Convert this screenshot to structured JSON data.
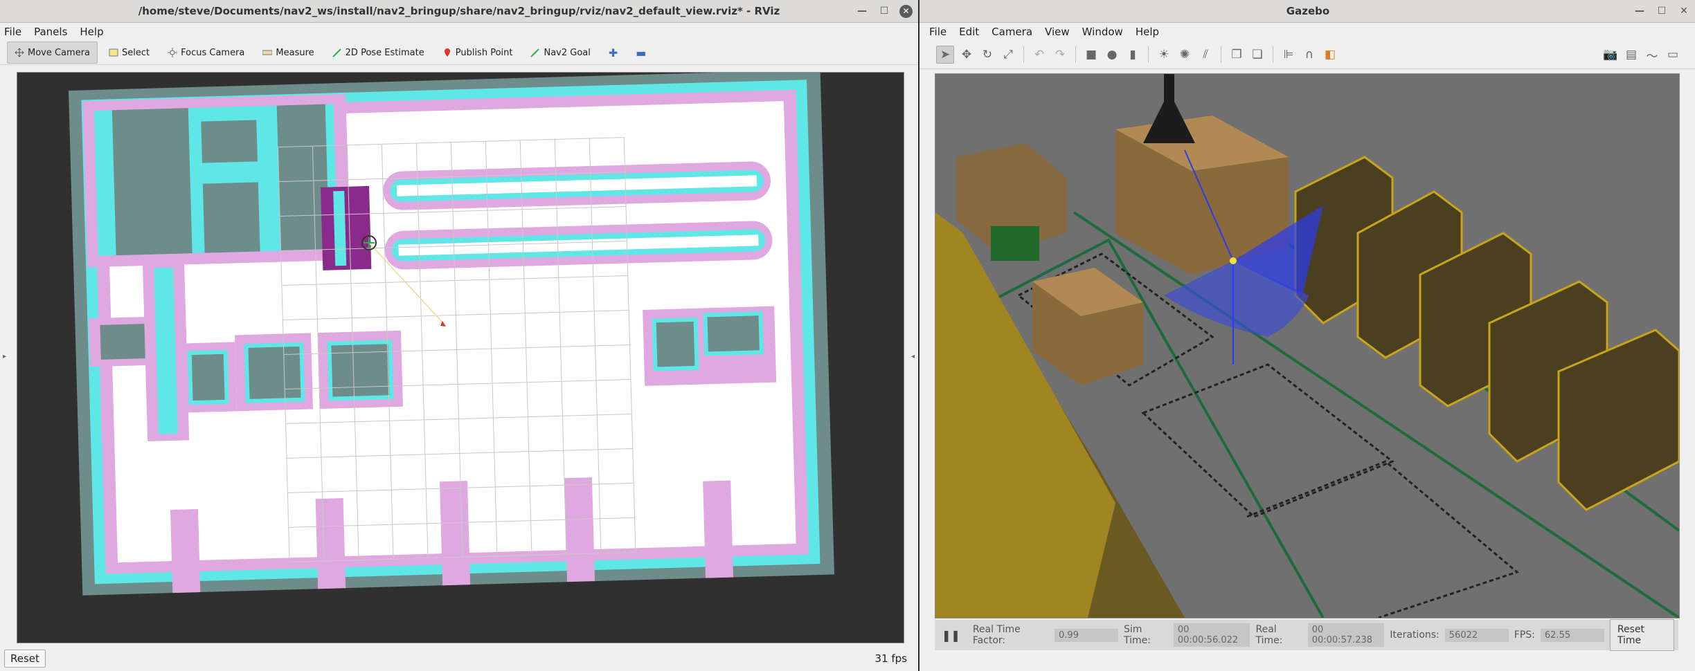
{
  "rviz": {
    "title": "/home/steve/Documents/nav2_ws/install/nav2_bringup/share/nav2_bringup/rviz/nav2_default_view.rviz* - RViz",
    "menu": [
      "File",
      "Panels",
      "Help"
    ],
    "tools": [
      {
        "label": "Move Camera",
        "icon": "move-camera-icon"
      },
      {
        "label": "Select",
        "icon": "select-icon"
      },
      {
        "label": "Focus Camera",
        "icon": "focus-camera-icon"
      },
      {
        "label": "Measure",
        "icon": "measure-icon"
      },
      {
        "label": "2D Pose Estimate",
        "icon": "pose-estimate-icon"
      },
      {
        "label": "Publish Point",
        "icon": "publish-point-icon"
      },
      {
        "label": "Nav2 Goal",
        "icon": "nav2-goal-icon"
      }
    ],
    "reset_label": "Reset",
    "fps": "31 fps",
    "colors": {
      "costmap_cyan": "#5fe6e6",
      "costmap_pink": "#e0a8e0",
      "costmap_purple": "#8a2a8a",
      "free": "#ffffff",
      "unknown": "#6e8c8a",
      "bg": "#303030"
    }
  },
  "gazebo": {
    "title": "Gazebo",
    "menu": [
      "File",
      "Edit",
      "Camera",
      "View",
      "Window",
      "Help"
    ],
    "status": {
      "rtf_label": "Real Time Factor:",
      "rtf_value": "0.99",
      "sim_label": "Sim Time:",
      "sim_value": "00 00:00:56.022",
      "real_label": "Real Time:",
      "real_value": "00 00:00:57.238",
      "iter_label": "Iterations:",
      "iter_value": "56022",
      "fps_label": "FPS:",
      "fps_value": "62.55",
      "reset_label": "Reset Time"
    }
  }
}
